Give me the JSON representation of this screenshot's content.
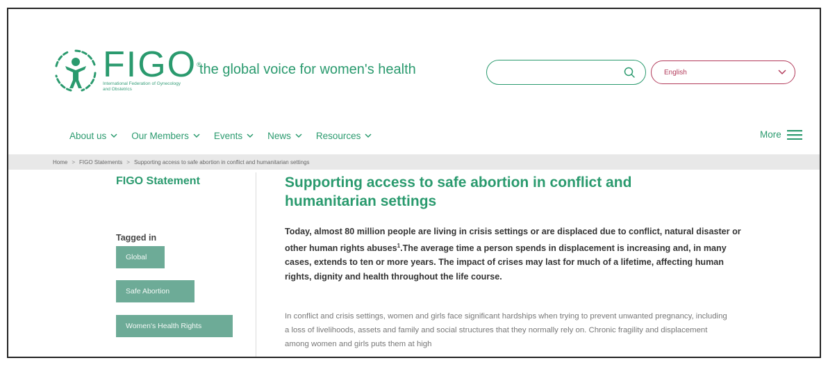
{
  "header": {
    "logo_name": "FIGO",
    "logo_reg": "®",
    "logo_sub": "International Federation of Gynecology and Obstetrics",
    "tagline": "the global voice for women's health",
    "search_placeholder": "",
    "language": "English"
  },
  "nav": {
    "items": [
      {
        "label": "About us"
      },
      {
        "label": "Our Members"
      },
      {
        "label": "Events"
      },
      {
        "label": "News"
      },
      {
        "label": "Resources"
      }
    ],
    "more_label": "More"
  },
  "breadcrumb": {
    "home": "Home",
    "sep": ">",
    "section": "FIGO Statements",
    "current": "Supporting access to safe abortion in conflict and humanitarian settings"
  },
  "sidebar": {
    "title": "FIGO Statement",
    "tagged_label": "Tagged in",
    "tags": [
      "Global",
      "Safe Abortion",
      "Women's Health Rights"
    ]
  },
  "main": {
    "title": "Supporting access to safe abortion in conflict and humanitarian settings",
    "lead_part1": "Today, almost 80 million people are living in crisis settings or are displaced due to conflict, natural disaster or other human rights abuses",
    "lead_sup": "1",
    "lead_part2": ".The average time a person spends in displacement is increasing and, in many cases, extends to ten or more years. The impact of crises may last for much of a lifetime, affecting human rights, dignity and health throughout the life course.",
    "paragraph": "In conflict and crisis settings, women and girls face significant hardships when trying to prevent unwanted pregnancy, including a loss of livelihoods, assets and family and social structures that they normally rely on. Chronic fragility and displacement among women and girls puts them at high"
  },
  "colors": {
    "brand_green": "#2a9a6e",
    "tag_bg": "#6dab97",
    "lang_accent": "#b23a5a"
  }
}
